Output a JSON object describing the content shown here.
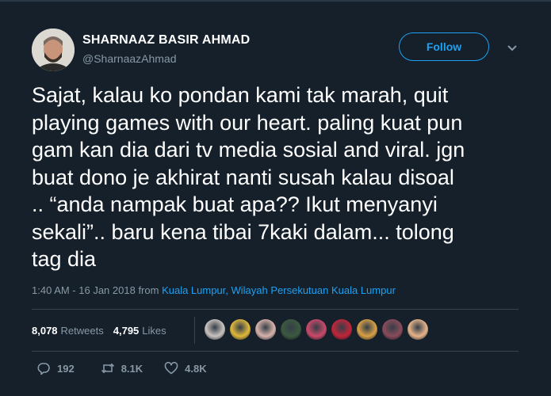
{
  "user": {
    "display_name": "SHARNAAZ BASIR AHMAD",
    "handle": "@SharnaazAhmad",
    "follow_label": "Follow"
  },
  "tweet": {
    "text": "Sajat, kalau ko pondan kami tak marah, quit\nplaying games with our heart. paling kuat pun\ngam kan dia dari tv media sosial and viral. jgn\nbuat dono je akhirat nanti susah kalau disoal\n.. “anda nampak buat apa?? Ikut menyanyi\nsekali”.. baru kena tibai 7kaki dalam... tolong\ntag dia",
    "timestamp": "1:40 AM - 16 Jan 2018",
    "from_label": "from",
    "location": "Kuala Lumpur, Wilayah Persekutuan Kuala Lumpur"
  },
  "stats": {
    "retweets_count": "8,078",
    "retweets_label": "Retweets",
    "likes_count": "4,795",
    "likes_label": "Likes"
  },
  "likers_colors": [
    "#c9c3bf",
    "#e0b93b",
    "#d7b3ab",
    "#3c5a40",
    "#c94a6a",
    "#c2253a",
    "#d8a047",
    "#8a4c5a",
    "#e6b48a"
  ],
  "actions": {
    "reply_count": "192",
    "retweet_count": "8.1K",
    "like_count": "4.8K"
  },
  "colors": {
    "background": "#15202b",
    "accent": "#1da1f2",
    "muted": "#8899a6",
    "divider": "#38444d"
  },
  "icons": [
    "reply-icon",
    "retweet-icon",
    "heart-icon",
    "chevron-down-icon"
  ]
}
